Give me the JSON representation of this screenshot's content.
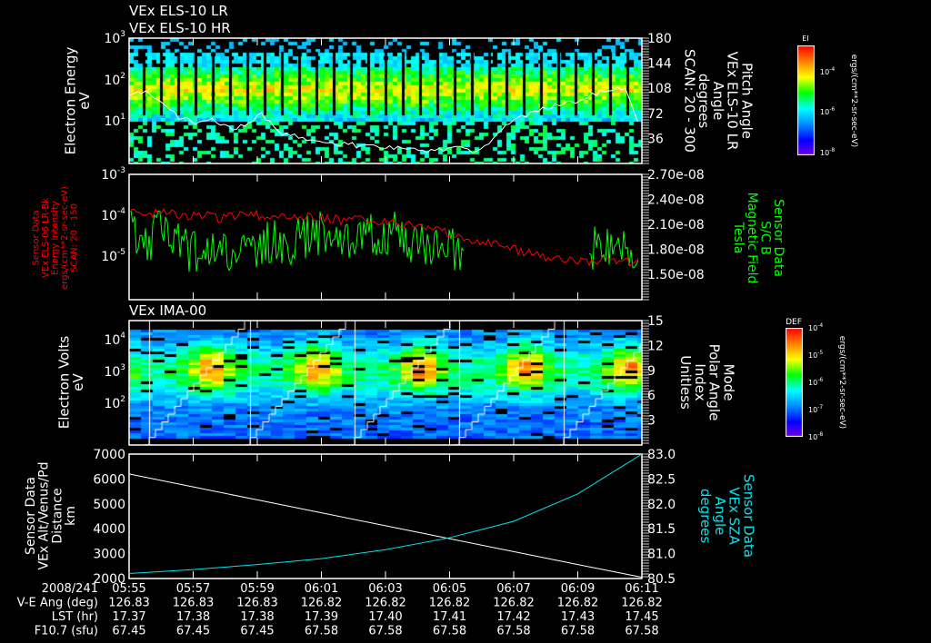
{
  "titles": {
    "panel1_a": "VEx ELS-10 LR",
    "panel1_b": "VEx ELS-10 HR",
    "panel3": "VEx IMA-00"
  },
  "colors": {
    "background": "#000000",
    "axis": "#ffffff",
    "red": "#ff0000",
    "green": "#00ff00",
    "cyan": "#00e5ee"
  },
  "chart_data": [
    {
      "type": "heatmap",
      "name": "ELS electron spectrogram",
      "ylabel": [
        "Electron Energy",
        "eV"
      ],
      "yscale": "log",
      "ylim": [
        1,
        1000
      ],
      "yticks": [
        "10^3",
        "10^2",
        "10^1"
      ],
      "y2label": [
        "Pitch Angle",
        "VEx ELS-10 LR",
        "Angle",
        "degrees",
        "SCAN: 20 - 300"
      ],
      "y2lim": [
        0,
        180
      ],
      "y2ticks": [
        "180",
        "144",
        "108",
        "72",
        "36"
      ],
      "overlay_line": {
        "name": "Pitch Angle",
        "color": "#ffffff",
        "values": [
          100,
          105,
          90,
          65,
          60,
          62,
          50,
          55,
          70,
          45,
          40,
          35,
          30,
          28,
          25,
          24,
          22,
          20,
          18,
          20,
          22,
          18,
          35,
          60,
          70,
          80,
          85,
          90,
          100,
          105,
          110,
          40
        ]
      },
      "colorbar": {
        "title": "EI",
        "ticks": [
          "10^-4",
          "10^-6",
          "10^-8"
        ],
        "units": "ergs/(cm**2-sr-sec-eV)"
      }
    },
    {
      "type": "line",
      "name": "ELS energy intensity and magnetic field",
      "ylabel": [
        "Sensor Data",
        "VEx ELS-06 LR-Bk",
        "Energy Intensity",
        "ergs/(cm**2-sr-sec-eV)",
        "SCAN: 20 - 150"
      ],
      "yscale": "log",
      "ylim": [
        1e-06,
        0.001
      ],
      "yticks": [
        "10^-3",
        "10^-4",
        "10^-5"
      ],
      "y2label": [
        "Sensor Data",
        "S/C B",
        "Magnetic Field",
        "Tesla"
      ],
      "y2lim": [
        1.2e-08,
        2.7e-08
      ],
      "y2ticks": [
        "2.70e-08",
        "2.40e-08",
        "2.10e-08",
        "1.80e-08",
        "1.50e-08"
      ],
      "series": [
        {
          "name": "Energy Intensity",
          "axis": "left",
          "color": "#ff0000",
          "values": [
            0.00012,
            0.00011,
            0.00013,
            0.0001,
            0.00011,
            9e-05,
            0.0001,
            0.00011,
            9.5e-05,
            0.0001,
            0.000105,
            9e-05,
            8e-05,
            9e-05,
            7.5e-05,
            7e-05,
            6e-05,
            5e-05,
            4e-05,
            3e-05,
            2.5e-05,
            2e-05,
            1.5e-05,
            1.2e-05,
            1e-05,
            9e-06,
            8e-06,
            9e-06,
            8e-06,
            9e-06
          ]
        },
        {
          "name": "S/C B",
          "axis": "right",
          "color": "#00ff00",
          "values": [
            2.05e-08,
            1.9e-08,
            2.1e-08,
            1.8e-08,
            1.75e-08,
            1.85e-08,
            1.7e-08,
            1.8e-08,
            1.9e-08,
            1.85e-08,
            1.95e-08,
            2e-08,
            1.9e-08,
            2e-08,
            1.95e-08,
            2.05e-08,
            1.9e-08,
            1.85e-08,
            1.8e-08,
            1.75e-08,
            null,
            null,
            null,
            null,
            null,
            null,
            1.8e-08,
            1.85e-08,
            1.9e-08,
            1.8e-08
          ]
        }
      ]
    },
    {
      "type": "heatmap",
      "name": "IMA spectrogram",
      "ylabel": [
        "Electron Volts",
        "eV"
      ],
      "yscale": "log",
      "ylim": [
        5,
        40000
      ],
      "yticks": [
        "10^4",
        "10^3",
        "10^2"
      ],
      "y2label": [
        "Mode",
        "Polar Angle",
        "Index",
        "Unitless"
      ],
      "y2lim": [
        0,
        15
      ],
      "y2ticks": [
        "15",
        "12",
        "9",
        "6",
        "3"
      ],
      "colorbar": {
        "title": "DEF",
        "ticks": [
          "10^-4",
          "10^-5",
          "10^-6",
          "10^-7",
          "10^-8"
        ],
        "units": "ergs/(cm**2-sr-sec-eV)"
      }
    },
    {
      "type": "line",
      "name": "Altitude and SZA",
      "ylabel": [
        "Sensor Data",
        "VEx Alt/Venus/Pd",
        "Distance",
        "km"
      ],
      "ylim": [
        2000,
        7000
      ],
      "yticks": [
        "7000",
        "6000",
        "5000",
        "4000",
        "3000",
        "2000"
      ],
      "y2label": [
        "Sensor Data",
        "VEx SZA",
        "Angle",
        "degrees"
      ],
      "y2lim": [
        80.5,
        83.0
      ],
      "y2ticks": [
        "83.0",
        "82.5",
        "82.0",
        "81.5",
        "81.0",
        "80.5"
      ],
      "series": [
        {
          "name": "Altitude",
          "axis": "left",
          "color": "#ffffff",
          "values": [
            6200,
            5680,
            5160,
            4640,
            4120,
            3600,
            3080,
            2560,
            2050
          ]
        },
        {
          "name": "SZA",
          "axis": "right",
          "color": "#00e5ee",
          "values": [
            80.6,
            80.68,
            80.78,
            80.9,
            81.08,
            81.32,
            81.65,
            82.2,
            83.0
          ]
        }
      ]
    }
  ],
  "xaxis": {
    "row_labels": [
      "2008/241",
      "V-E Ang (deg)",
      "LST (hr)",
      "F10.7 (sfu)"
    ],
    "times": [
      "05:55",
      "05:57",
      "05:59",
      "06:01",
      "06:03",
      "06:05",
      "06:07",
      "06:09",
      "06:11"
    ],
    "ve_ang": [
      "126.83",
      "126.83",
      "126.83",
      "126.82",
      "126.82",
      "126.82",
      "126.82",
      "126.82",
      "126.82"
    ],
    "lst": [
      "17.37",
      "17.38",
      "17.38",
      "17.39",
      "17.40",
      "17.41",
      "17.42",
      "17.43",
      "17.45"
    ],
    "f107": [
      "67.45",
      "67.45",
      "67.45",
      "67.58",
      "67.58",
      "67.58",
      "67.58",
      "67.58",
      "67.58"
    ]
  }
}
